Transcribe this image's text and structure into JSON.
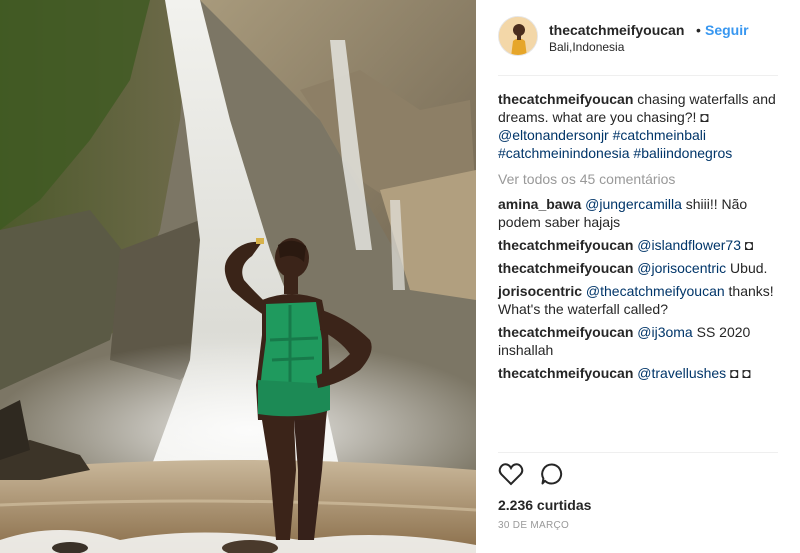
{
  "post": {
    "username": "thecatchmeifyoucan",
    "separator": "•",
    "follow_label": "Seguir",
    "location": "Bali,Indonesia",
    "photo_icon": "waterfall-photo",
    "caption": {
      "username": "thecatchmeifyoucan",
      "text": "chasing waterfalls and dreams. what are you chasing?! ◘ ",
      "mention": "@eltonandersonjr",
      "tags": [
        "#catchmeinbali",
        "#catchmeinindonesia",
        "#baliindonegros"
      ]
    },
    "view_all": "Ver todos os 45 comentários",
    "comments": [
      {
        "username": "amina_bawa",
        "mention": "@jungercamilla",
        "text": " shiii!! Não podem saber hajajs"
      },
      {
        "username": "thecatchmeifyoucan",
        "mention": "@islandflower73",
        "text": " ◘"
      },
      {
        "username": "thecatchmeifyoucan",
        "mention": "@jorisocentric",
        "text": " Ubud."
      },
      {
        "username": "jorisocentric",
        "mention": "@thecatchmeifyoucan",
        "text": " thanks! What's the waterfall called?"
      },
      {
        "username": "thecatchmeifyoucan",
        "mention": "@ij3oma",
        "text": " SS 2020 inshallah"
      },
      {
        "username": "thecatchmeifyoucan",
        "mention": "@travellushes",
        "text": " ◘ ◘"
      }
    ],
    "likes": "2.236 curtidas",
    "date": "30 DE MARÇO",
    "icons": {
      "like": "heart-icon",
      "comment": "comment-bubble-icon"
    },
    "colors": {
      "link": "#003569",
      "follow": "#3897f0",
      "muted": "#999999"
    }
  }
}
